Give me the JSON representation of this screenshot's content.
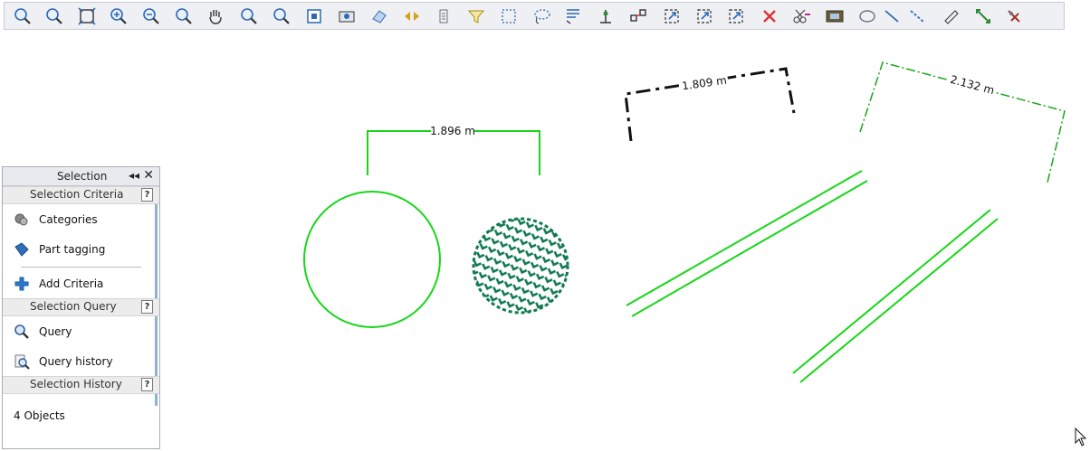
{
  "toolbar": {
    "buttons": [
      "zoom-original-icon",
      "zoom-previous-icon",
      "zoom-extents-icon",
      "zoom-in-icon",
      "zoom-out-icon",
      "zoom-selected-icon",
      "pan-hand-icon",
      "zoom-window-icon",
      "zoom-fit-icon",
      "frame-icon",
      "screenshot-icon",
      "eraser-icon",
      "arrows-icon",
      "list-icon",
      "filter-icon",
      "select-area-icon",
      "lasso-icon",
      "properties-icon",
      "align-icon",
      "snap-icon",
      "move-icon",
      "copy-icon",
      "transform-icon",
      "delete-icon",
      "cut-icon",
      "film-icon",
      "ellipse-icon",
      "line-icon",
      "dashed-line-icon",
      "ruler-icon",
      "measure-icon",
      "tag-icon"
    ]
  },
  "drawing": {
    "dim_circle": "1.896 m",
    "dim_rect": "1.809 m",
    "dim_right": "2.132 m"
  },
  "panel": {
    "title": "Selection",
    "collapse_glyph": "◂◂",
    "close_glyph": "✕",
    "criteria_header": "Selection Criteria",
    "help_glyph": "?",
    "categories_label": "Categories",
    "part_tagging_label": "Part tagging",
    "add_criteria_label": "Add Criteria",
    "query_header": "Selection Query",
    "query_label": "Query",
    "query_history_label": "Query history",
    "history_header": "Selection History",
    "status": "4 Objects"
  },
  "colors": {
    "selected_green": "#19d619",
    "hatch_green": "#0f7a4e",
    "panel_accent": "#8db0d8"
  }
}
